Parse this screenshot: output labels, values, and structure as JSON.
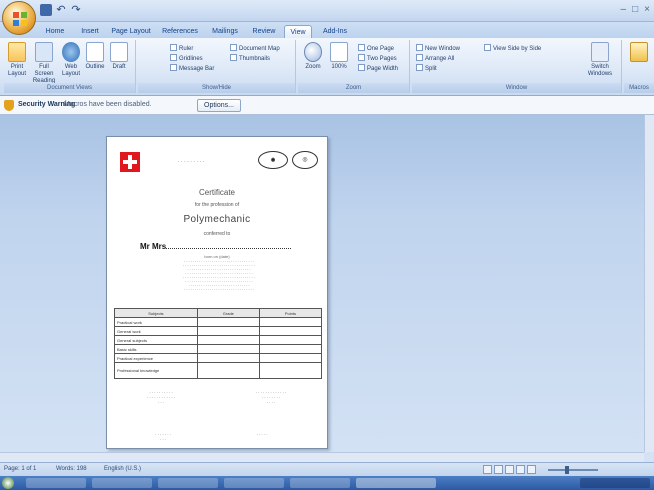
{
  "titlebar": {
    "title": "",
    "icons": [
      "office-logo",
      "save-icon",
      "undo-icon",
      "redo-icon"
    ]
  },
  "tabs": [
    "Home",
    "Insert",
    "Page Layout",
    "References",
    "Mailings",
    "Review",
    "View",
    "Add-Ins"
  ],
  "ribbon": {
    "views_group": {
      "label": "Document Views",
      "buttons": [
        "Print Layout",
        "Full Screen Reading",
        "Web Layout",
        "Outline",
        "Draft"
      ]
    },
    "show_hide_group": {
      "label": "Show/Hide",
      "items": [
        "Ruler",
        "Gridlines",
        "Message Bar",
        "Document Map",
        "Thumbnails"
      ]
    },
    "zoom_group": {
      "label": "Zoom",
      "buttons": [
        "Zoom",
        "100%"
      ],
      "items": [
        "One Page",
        "Two Pages",
        "Page Width"
      ]
    },
    "window_group": {
      "label": "Window",
      "items": [
        "New Window",
        "Arrange All",
        "Split",
        "View Side by Side",
        "Switch Windows"
      ]
    },
    "macros_group": {
      "label": "Macros"
    }
  },
  "message_bar": {
    "title": "Security Warning",
    "text": "Macros have been disabled.",
    "button": "Options..."
  },
  "document": {
    "cert_title": "Certificate",
    "cert_sub": "for the profession of",
    "profession": "Polymechanic",
    "conferred": "conferred to",
    "name": "Mr Mrs",
    "born": "born on (date)",
    "table_headers": [
      "Subjects",
      "Grade",
      "Points"
    ],
    "table_rows": [
      [
        "Practical work",
        "",
        ""
      ],
      [
        "General work",
        "",
        ""
      ],
      [
        "General subjects",
        "",
        ""
      ],
      [
        "Basic skills",
        "",
        ""
      ],
      [
        "Practical experience",
        "",
        ""
      ],
      [
        "Professional knowledge",
        "",
        ""
      ]
    ]
  },
  "statusbar": {
    "page": "Page: 1 of 1",
    "words": "Words: 198",
    "lang": "English (U.S.)"
  },
  "colors": {
    "accent": "#15428b",
    "workspace": "#c0d4ee",
    "swiss_red": "#e1171e"
  }
}
